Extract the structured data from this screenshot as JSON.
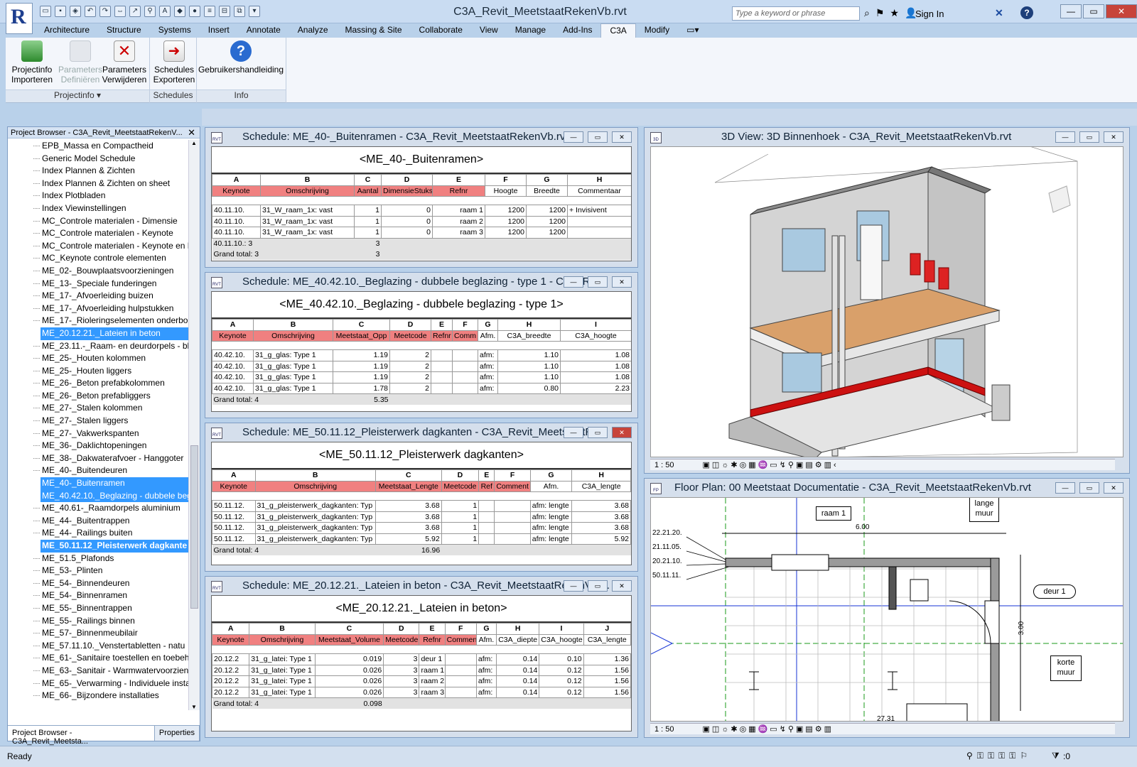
{
  "window": {
    "title": "C3A_Revit_MeetstaatRekenVb.rvt",
    "app_logo": "R",
    "search_placeholder": "Type a keyword or phrase",
    "sign_in": "Sign In"
  },
  "tabs": [
    "Architecture",
    "Structure",
    "Systems",
    "Insert",
    "Annotate",
    "Analyze",
    "Massing & Site",
    "Collaborate",
    "View",
    "Manage",
    "Add-Ins",
    "C3A",
    "Modify"
  ],
  "active_tab": "C3A",
  "ribbon": {
    "buttons": [
      {
        "l1": "Projectinfo",
        "l2": "Importeren",
        "icon": "database-import-icon"
      },
      {
        "l1": "Parameters",
        "l2": "Definiëren",
        "icon": "parameters-define-icon",
        "disabled": true
      },
      {
        "l1": "Parameters",
        "l2": "Verwijderen",
        "icon": "parameters-delete-icon"
      },
      {
        "l1": "Schedules",
        "l2": "Exporteren",
        "icon": "schedule-export-icon"
      },
      {
        "l1": "Gebruikershandleiding",
        "l2": "",
        "icon": "help-icon"
      }
    ],
    "panels": [
      "Projectinfo",
      "Schedules",
      "Info"
    ]
  },
  "project_browser": {
    "title": "Project Browser - C3A_Revit_MeetstaatRekenV...",
    "items": [
      "EPB_Massa en Compactheid",
      "Generic Model Schedule",
      "Index Plannen & Zichten",
      "Index Plannen & Zichten on sheet",
      "Index Plotbladen",
      "Index Viewinstellingen",
      "MC_Controle materialen - Dimensie",
      "MC_Controle materialen - Keynote",
      "MC_Controle materialen - Keynote en D",
      "MC_Keynote controle elementen",
      "ME_02-_Bouwplaatsvoorzieningen",
      "ME_13-_Speciale funderingen",
      "ME_17-_Afvoerleiding buizen",
      "ME_17-_Afvoerleiding hulpstukken",
      "ME_17-_Rioleringselementen onderbo",
      "ME_20.12.21._Lateien in beton",
      "ME_23.11.-_Raam- en deurdorpels - bl",
      "ME_25-_Houten kolommen",
      "ME_25-_Houten liggers",
      "ME_26-_Beton prefabkolommen",
      "ME_26-_Beton prefabliggers",
      "ME_27-_Stalen kolommen",
      "ME_27-_Stalen liggers",
      "ME_27-_Vakwerkspanten",
      "ME_36-_Daklichtopeningen",
      "ME_38-_Dakwaterafvoer - Hanggoter",
      "ME_40-_Buitendeuren",
      "ME_40-_Buitenramen",
      "ME_40.42.10._Beglazing - dubbele beg",
      "ME_40.61-_Raamdorpels aluminium",
      "ME_44-_Buitentrappen",
      "ME_44-_Railings buiten",
      "ME_50.11.12_Pleisterwerk dagkante",
      "ME_51.5_Plafonds",
      "ME_53-_Plinten",
      "ME_54-_Binnendeuren",
      "ME_54-_Binnenramen",
      "ME_55-_Binnentrappen",
      "ME_55-_Railings binnen",
      "ME_57-_Binnenmeubilair",
      "ME_57.11.10._Venstertabletten - natu",
      "ME_61-_Sanitaire toestellen en toebeh",
      "ME_63-_Sanitair - Warmwatervoorzien",
      "ME_65-_Verwarming - Individuele insta",
      "ME_66-_Bijzondere installaties"
    ],
    "selected": [
      15,
      27,
      28,
      32
    ],
    "tabs": [
      "Project Browser - C3A_Revit_Meetsta...",
      "Properties"
    ]
  },
  "schedules": [
    {
      "title": "Schedule: ME_40-_Buitenramen - C3A_Revit_MeetstaatRekenVb.rvt",
      "heading": "<ME_40-_Buitenramen>",
      "letters": [
        "A",
        "B",
        "C",
        "D",
        "E",
        "F",
        "G",
        "H"
      ],
      "headers": [
        "Keynote",
        "Omschrijving",
        "Aantal",
        "DimensieStuks",
        "Refnr",
        "Hoogte",
        "Breedte",
        "Commentaar"
      ],
      "red": [
        0,
        1,
        2,
        3,
        4
      ],
      "widths": [
        68,
        132,
        38,
        72,
        74,
        58,
        58,
        90
      ],
      "rows": [
        [
          "40.11.10.",
          "31_W_raam_1x: vast",
          "1",
          "0",
          "raam 1",
          "1200",
          "1200",
          "+ Invisivent"
        ],
        [
          "40.11.10.",
          "31_W_raam_1x: vast",
          "1",
          "0",
          "raam 2",
          "1200",
          "1200",
          ""
        ],
        [
          "40.11.10.",
          "31_W_raam_1x: vast",
          "1",
          "0",
          "raam 3",
          "1200",
          "1200",
          ""
        ]
      ],
      "right": [
        2,
        3,
        4,
        5,
        6
      ],
      "totals": [
        [
          "40.11.10.: 3",
          "",
          "3"
        ],
        [
          "Grand total: 3",
          "",
          "3"
        ]
      ]
    },
    {
      "title": "Schedule: ME_40.42.10._Beglazing - dubbele beglazing - type 1 - C3A_R...",
      "heading": "<ME_40.42.10._Beglazing - dubbele beglazing - type 1>",
      "letters": [
        "A",
        "B",
        "C",
        "D",
        "E",
        "F",
        "G",
        "H",
        "I"
      ],
      "headers": [
        "Keynote",
        "Omschrijving",
        "Meetstaat_Opp",
        "Meetcode",
        "Refnr",
        "Comm",
        "Afm.",
        "C3A_breedte",
        "C3A_hoogte"
      ],
      "red": [
        0,
        1,
        2,
        3,
        4,
        5
      ],
      "widths": [
        58,
        112,
        80,
        58,
        30,
        36,
        28,
        88,
        100
      ],
      "rows": [
        [
          "40.42.10.",
          "31_g_glas: Type 1",
          "1.19",
          "2",
          "",
          "",
          "afm:",
          "1.10",
          "1.08"
        ],
        [
          "40.42.10.",
          "31_g_glas: Type 1",
          "1.19",
          "2",
          "",
          "",
          "afm:",
          "1.10",
          "1.08"
        ],
        [
          "40.42.10.",
          "31_g_glas: Type 1",
          "1.19",
          "2",
          "",
          "",
          "afm:",
          "1.10",
          "1.08"
        ],
        [
          "40.42.10.",
          "31_g_glas: Type 1",
          "1.78",
          "2",
          "",
          "",
          "afm:",
          "0.80",
          "2.23"
        ]
      ],
      "right": [
        2,
        3,
        7,
        8
      ],
      "totals": [
        [
          "Grand total: 4",
          "",
          "5.35"
        ]
      ]
    },
    {
      "title": "Schedule: ME_50.11.12_Pleisterwerk dagkanten - C3A_Revit_MeetstaatRe...",
      "heading": "<ME_50.11.12_Pleisterwerk dagkanten>",
      "letters": [
        "A",
        "B",
        "C",
        "D",
        "E",
        "F",
        "G",
        "H"
      ],
      "headers": [
        "Keynote",
        "Omschrijving",
        "Meetstaat_Lengte",
        "Meetcode",
        "Ref",
        "Comment",
        "Afm.",
        "C3A_lengte"
      ],
      "red": [
        0,
        1,
        2,
        3,
        4,
        5
      ],
      "widths": [
        60,
        168,
        92,
        52,
        22,
        50,
        58,
        82
      ],
      "rows": [
        [
          "50.11.12.",
          "31_g_pleisterwerk_dagkanten: Typ",
          "3.68",
          "1",
          "",
          "",
          "afm: lengte",
          "3.68"
        ],
        [
          "50.11.12.",
          "31_g_pleisterwerk_dagkanten: Typ",
          "3.68",
          "1",
          "",
          "",
          "afm: lengte",
          "3.68"
        ],
        [
          "50.11.12.",
          "31_g_pleisterwerk_dagkanten: Typ",
          "3.68",
          "1",
          "",
          "",
          "afm: lengte",
          "3.68"
        ],
        [
          "50.11.12.",
          "31_g_pleisterwerk_dagkanten: Typ",
          "5.92",
          "1",
          "",
          "",
          "afm: lengte",
          "5.92"
        ]
      ],
      "right": [
        2,
        3,
        7
      ],
      "totals": [
        [
          "Grand total: 4",
          "",
          "16.96"
        ]
      ]
    },
    {
      "title": "Schedule: ME_20.12.21._Lateien in beton - C3A_Revit_MeetstaatRekenVb....",
      "heading": "<ME_20.12.21._Lateien in beton>",
      "letters": [
        "A",
        "B",
        "C",
        "D",
        "E",
        "F",
        "G",
        "H",
        "I",
        "J"
      ],
      "headers": [
        "Keynote",
        "Omschrijving",
        "Meetstaat_Volume",
        "Meetcode",
        "Refnr",
        "Comment",
        "Afm.",
        "C3A_diepte",
        "C3A_hoogte",
        "C3A_lengte"
      ],
      "red": [
        0,
        1,
        2,
        3,
        4,
        5
      ],
      "widths": [
        52,
        92,
        96,
        50,
        36,
        44,
        28,
        60,
        62,
        66
      ],
      "rows": [
        [
          "20.12.2",
          "31_g_latei: Type 1",
          "0.019",
          "3",
          "deur 1",
          "",
          "afm:",
          "0.14",
          "0.10",
          "1.36"
        ],
        [
          "20.12.2",
          "31_g_latei: Type 1",
          "0.026",
          "3",
          "raam 1",
          "",
          "afm:",
          "0.14",
          "0.12",
          "1.56"
        ],
        [
          "20.12.2",
          "31_g_latei: Type 1",
          "0.026",
          "3",
          "raam 2",
          "",
          "afm:",
          "0.14",
          "0.12",
          "1.56"
        ],
        [
          "20.12.2",
          "31_g_latei: Type 1",
          "0.026",
          "3",
          "raam 3",
          "",
          "afm:",
          "0.14",
          "0.12",
          "1.56"
        ]
      ],
      "right": [
        2,
        3,
        7,
        8,
        9
      ],
      "totals": [
        [
          "Grand total: 4",
          "",
          "0.098"
        ]
      ]
    }
  ],
  "view3d": {
    "title": "3D View: 3D Binnenhoek - C3A_Revit_MeetstaatRekenVb.rvt",
    "scale": "1 : 50"
  },
  "plan": {
    "title": "Floor Plan: 00 Meetstaat Documentatie - C3A_Revit_MeetstaatRekenVb.rvt",
    "scale": "1 : 50",
    "tags": {
      "raam": "raam 1",
      "lange": "lange muur",
      "deur": "deur 1",
      "korte": "korte muur"
    },
    "levels": [
      "22.21.20.",
      "21.11.05.",
      "20.21.10.",
      "50.11.11."
    ],
    "dims": {
      "width": "6.00",
      "height": "3.00",
      "bottom": "27.31"
    }
  },
  "status": {
    "text": "Ready",
    "filter": ":0"
  }
}
